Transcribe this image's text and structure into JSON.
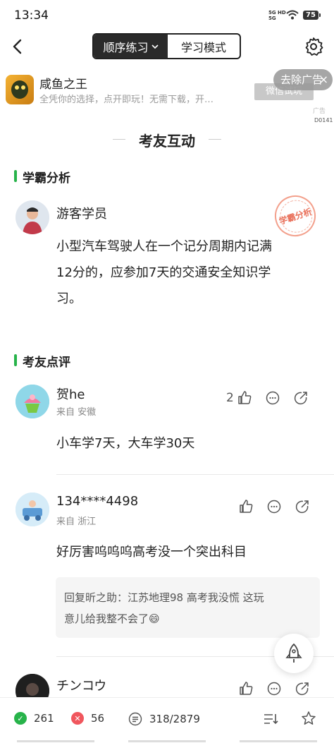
{
  "status_bar": {
    "time": "13:34",
    "network_top": "5G HD",
    "network_bottom": "5G",
    "battery": "75"
  },
  "nav": {
    "mode_selected": "顺序练习",
    "mode_other": "学习模式"
  },
  "ad": {
    "title": "咸鱼之王",
    "description": "全凭你的选择，点开即玩！无需下载，开…",
    "cta": "微信试玩",
    "remove_label": "去除广告",
    "ad_label": "广告",
    "code": "D0141"
  },
  "section": {
    "title": "考友互动"
  },
  "analysis": {
    "label": "学霸分析",
    "stamp": "学霸分析",
    "user": "游客学员",
    "text_lines": [
      "小型汽车驾驶人在一个记分周期内记满",
      "12分的，应参加7天的交通安全知识学",
      "习。"
    ]
  },
  "reviews_label": "考友点评",
  "reviews": [
    {
      "user": "贺he",
      "from": "来自 安徽",
      "likes": "2",
      "text": "小车学7天，大车学30天"
    },
    {
      "user": "134****4498",
      "from": "来自 浙江",
      "likes": "",
      "text": "好厉害呜呜呜高考没一个突出科目",
      "reply_line1": "回复昕之助：江苏地理98 高考我没慌 这玩",
      "reply_line2": "意儿给我整不会了😄"
    },
    {
      "user": "チンコウ",
      "from": "",
      "likes": "",
      "text": ""
    }
  ],
  "bottom": {
    "correct": "261",
    "wrong": "56",
    "progress": "318/2879"
  },
  "colors": {
    "accent": "#27b34a",
    "wrong": "#f0565d"
  }
}
